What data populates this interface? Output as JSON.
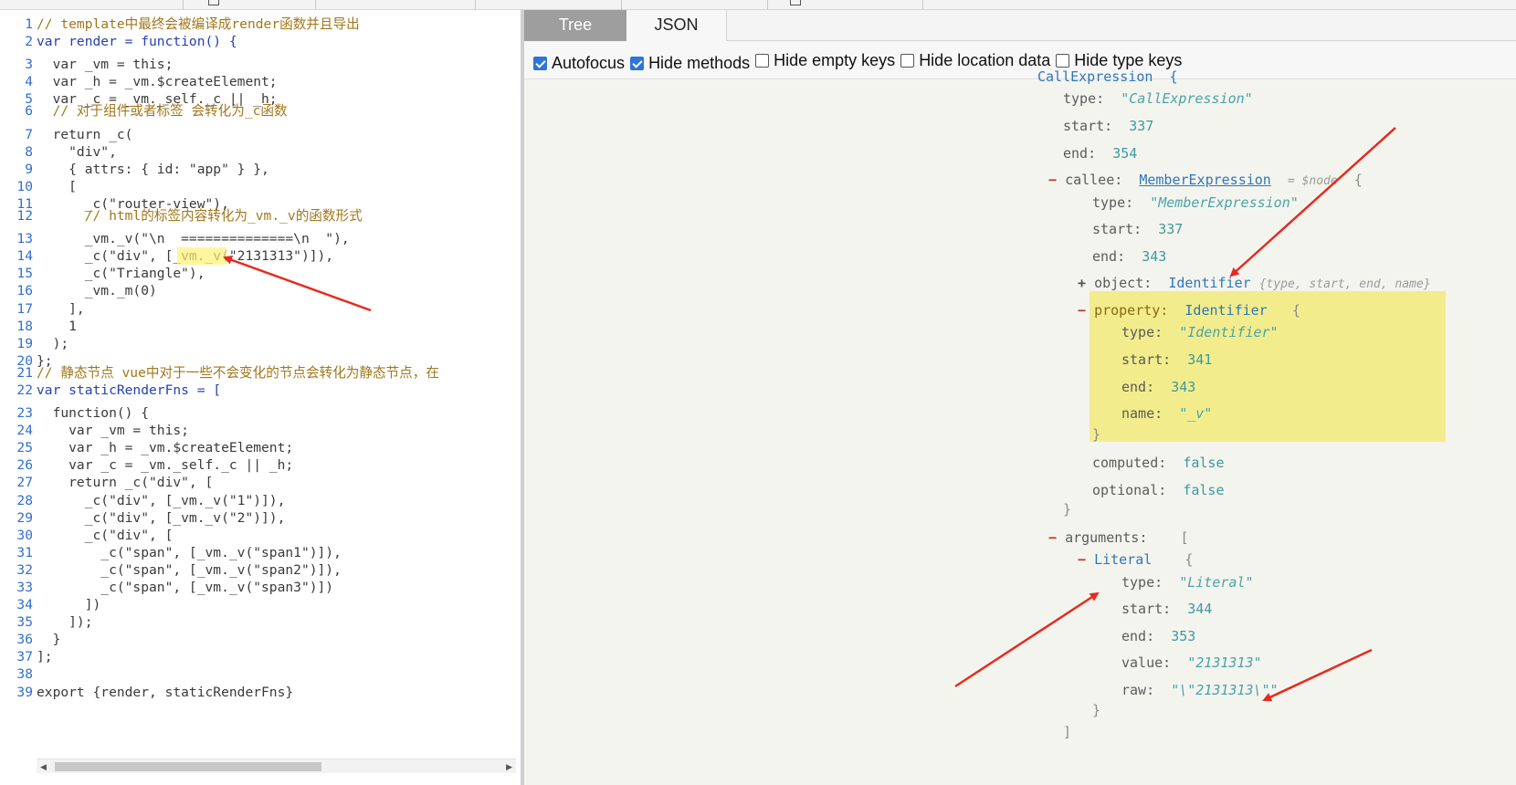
{
  "editor": {
    "lines": [
      {
        "n": "1",
        "text": "// template中最终会被编译成render函数并且导出",
        "kind": "comment"
      },
      {
        "n": "2",
        "text": "var render = function() {",
        "kind": "kw"
      },
      {
        "n": "3",
        "text": "  var _vm = this;",
        "kind": "code"
      },
      {
        "n": "4",
        "text": "  var _h = _vm.$createElement;",
        "kind": "code"
      },
      {
        "n": "5",
        "text": "  var _c = _vm._self._c || _h;",
        "kind": "code"
      },
      {
        "n": "6",
        "text": "  // 对于组件或者标签 会转化为_c函数",
        "kind": "comment"
      },
      {
        "n": "7",
        "text": "  return _c(",
        "kind": "code"
      },
      {
        "n": "8",
        "text": "    \"div\",",
        "kind": "code"
      },
      {
        "n": "9",
        "text": "    { attrs: { id: \"app\" } },",
        "kind": "code"
      },
      {
        "n": "10",
        "text": "    [",
        "kind": "code"
      },
      {
        "n": "11",
        "text": "      _c(\"router-view\"),",
        "kind": "code"
      },
      {
        "n": "12",
        "text": "      // html的标签内容转化为_vm._v的函数形式",
        "kind": "comment"
      },
      {
        "n": "13",
        "text": "      _vm._v(\"\\n  ==============\\n  \"),",
        "kind": "code"
      },
      {
        "n": "14",
        "text": "      _c(\"div\", [_vm._v(\"2131313\")]),",
        "kind": "code"
      },
      {
        "n": "15",
        "text": "      _c(\"Triangle\"),",
        "kind": "code"
      },
      {
        "n": "16",
        "text": "      _vm._m(0)",
        "kind": "code"
      },
      {
        "n": "17",
        "text": "    ],",
        "kind": "code"
      },
      {
        "n": "18",
        "text": "    1",
        "kind": "code"
      },
      {
        "n": "19",
        "text": "  );",
        "kind": "code"
      },
      {
        "n": "20",
        "text": "};",
        "kind": "code"
      },
      {
        "n": "21",
        "text": "// 静态节点 vue中对于一些不会变化的节点会转化为静态节点，在",
        "kind": "comment"
      },
      {
        "n": "22",
        "text": "var staticRenderFns = [",
        "kind": "kw"
      },
      {
        "n": "23",
        "text": "  function() {",
        "kind": "code"
      },
      {
        "n": "24",
        "text": "    var _vm = this;",
        "kind": "code"
      },
      {
        "n": "25",
        "text": "    var _h = _vm.$createElement;",
        "kind": "code"
      },
      {
        "n": "26",
        "text": "    var _c = _vm._self._c || _h;",
        "kind": "code"
      },
      {
        "n": "27",
        "text": "    return _c(\"div\", [",
        "kind": "code"
      },
      {
        "n": "28",
        "text": "      _c(\"div\", [_vm._v(\"1\")]),",
        "kind": "code"
      },
      {
        "n": "29",
        "text": "      _c(\"div\", [_vm._v(\"2\")]),",
        "kind": "code"
      },
      {
        "n": "30",
        "text": "      _c(\"div\", [",
        "kind": "code"
      },
      {
        "n": "31",
        "text": "        _c(\"span\", [_vm._v(\"span1\")]),",
        "kind": "code"
      },
      {
        "n": "32",
        "text": "        _c(\"span\", [_vm._v(\"span2\")]),",
        "kind": "code"
      },
      {
        "n": "33",
        "text": "        _c(\"span\", [_vm._v(\"span3\")])",
        "kind": "code"
      },
      {
        "n": "34",
        "text": "      ])",
        "kind": "code"
      },
      {
        "n": "35",
        "text": "    ]);",
        "kind": "code"
      },
      {
        "n": "36",
        "text": "  }",
        "kind": "code"
      },
      {
        "n": "37",
        "text": "];",
        "kind": "code"
      },
      {
        "n": "38",
        "text": "",
        "kind": "code"
      },
      {
        "n": "39",
        "text": "export {render, staticRenderFns}",
        "kind": "code"
      }
    ]
  },
  "tabs": {
    "tree": "Tree",
    "json": "JSON",
    "active": "tree"
  },
  "options": [
    {
      "label": "Autofocus",
      "checked": true
    },
    {
      "label": "Hide methods",
      "checked": true
    },
    {
      "label": "Hide empty keys",
      "checked": false
    },
    {
      "label": "Hide location data",
      "checked": false
    },
    {
      "label": "Hide type keys",
      "checked": false
    }
  ],
  "tree": {
    "top": {
      "type_key": "type:",
      "type_val": "\"CallExpression\"",
      "start_key": "start:",
      "start_val": "337",
      "end_key": "end:",
      "end_val": "354"
    },
    "callee": {
      "key": "callee:",
      "type": "MemberExpression",
      "node": "= $node",
      "brace": "{",
      "type_key": "type:",
      "type_val": "\"MemberExpression\"",
      "start_key": "start:",
      "start_val": "337",
      "end_key": "end:",
      "end_val": "343"
    },
    "object": {
      "key": "object:",
      "type": "Identifier",
      "summary": "{type, start, end, name}"
    },
    "property": {
      "key": "property:",
      "type": "Identifier",
      "brace": "{",
      "type_key": "type:",
      "type_val": "\"Identifier\"",
      "start_key": "start:",
      "start_val": "341",
      "end_key": "end:",
      "end_val": "343",
      "name_key": "name:",
      "name_val": "\"_v\"",
      "close": "}"
    },
    "computed": {
      "key": "computed:",
      "val": "false"
    },
    "optional": {
      "key": "optional:",
      "val": "false"
    },
    "callee_close": "}",
    "arguments": {
      "key": "arguments:",
      "bracket": "[",
      "close": "]"
    },
    "literal": {
      "type": "Literal",
      "brace": "{",
      "type_key": "type:",
      "type_val": "\"Literal\"",
      "start_key": "start:",
      "start_val": "344",
      "end_key": "end:",
      "end_val": "353",
      "value_key": "value:",
      "value_val": "\"2131313\"",
      "raw_key": "raw:",
      "raw_val": "\"\\\"2131313\\\"\"",
      "close": "}"
    }
  },
  "annotation_color": "#e52b20"
}
